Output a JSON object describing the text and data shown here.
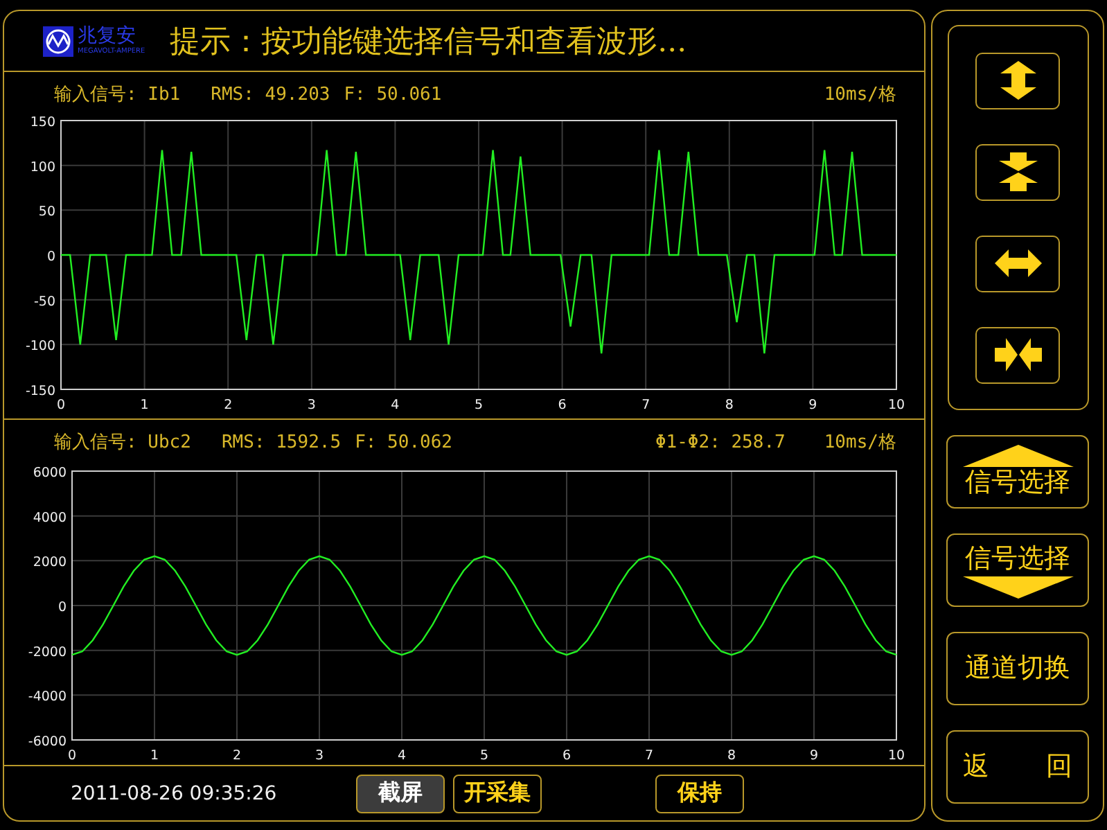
{
  "header": {
    "logo": {
      "name": "兆复安",
      "subtitle": "MEGAVOLT-AMPERE"
    },
    "prompt": "提示：按功能键选择信号和查看波形..."
  },
  "panels": [
    {
      "signal": "输入信号: Ib1",
      "readings": [
        "RMS: 49.203",
        "F: 50.061"
      ],
      "right_readings": [
        "10ms/格"
      ],
      "chart_data": {
        "type": "line",
        "grid": true,
        "xlim": [
          0,
          10
        ],
        "ylim": [
          -150,
          150
        ],
        "xticks": [
          0,
          1,
          2,
          3,
          4,
          5,
          6,
          7,
          8,
          9,
          10
        ],
        "yticks": [
          -150,
          -100,
          -50,
          0,
          50,
          100,
          150
        ],
        "x": [
          0,
          0.11,
          0.23,
          0.35,
          0.54,
          0.66,
          0.78,
          1.09,
          1.21,
          1.33,
          1.44,
          1.56,
          1.68,
          2.1,
          2.22,
          2.34,
          2.42,
          2.54,
          2.66,
          3.06,
          3.18,
          3.3,
          3.41,
          3.53,
          3.65,
          4.06,
          4.18,
          4.3,
          4.52,
          4.64,
          4.76,
          5.05,
          5.17,
          5.29,
          5.38,
          5.5,
          5.62,
          5.98,
          6.1,
          6.22,
          6.35,
          6.47,
          6.59,
          7.04,
          7.16,
          7.28,
          7.39,
          7.51,
          7.63,
          7.97,
          8.09,
          8.21,
          8.3,
          8.42,
          8.54,
          9.02,
          9.14,
          9.26,
          9.35,
          9.47,
          9.59,
          10
        ],
        "series": [
          {
            "color": "#22ee22",
            "values": [
              0,
              0,
              -100,
              0,
              0,
              -95,
              0,
              0,
              117,
              0,
              0,
              115,
              0,
              0,
              -95,
              0,
              0,
              -100,
              0,
              0,
              117,
              0,
              0,
              115,
              0,
              0,
              -95,
              0,
              0,
              -100,
              0,
              0,
              117,
              0,
              0,
              110,
              0,
              0,
              -80,
              0,
              0,
              -110,
              0,
              0,
              117,
              0,
              0,
              115,
              0,
              0,
              -75,
              0,
              0,
              -110,
              0,
              0,
              117,
              0,
              0,
              115,
              0,
              0
            ]
          }
        ]
      }
    },
    {
      "signal": "输入信号: Ubc2",
      "readings": [
        "RMS: 1592.5",
        "F: 50.062"
      ],
      "right_readings": [
        "Φ1-Φ2: 258.7",
        "10ms/格"
      ],
      "chart_data": {
        "type": "line",
        "grid": true,
        "xlim": [
          0,
          10
        ],
        "ylim": [
          -6000,
          6000
        ],
        "xticks": [
          0,
          1,
          2,
          3,
          4,
          5,
          6,
          7,
          8,
          9,
          10
        ],
        "yticks": [
          -6000,
          -4000,
          -2000,
          0,
          2000,
          4000,
          6000
        ],
        "x": [
          0,
          0.125,
          0.25,
          0.375,
          0.5,
          0.625,
          0.75,
          0.875,
          1,
          1.125,
          1.25,
          1.375,
          1.5,
          1.625,
          1.75,
          1.875,
          2,
          2.125,
          2.25,
          2.375,
          2.5,
          2.625,
          2.75,
          2.875,
          3,
          3.125,
          3.25,
          3.375,
          3.5,
          3.625,
          3.75,
          3.875,
          4,
          4.125,
          4.25,
          4.375,
          4.5,
          4.625,
          4.75,
          4.875,
          5,
          5.125,
          5.25,
          5.375,
          5.5,
          5.625,
          5.75,
          5.875,
          6,
          6.125,
          6.25,
          6.375,
          6.5,
          6.625,
          6.75,
          6.875,
          7,
          7.125,
          7.25,
          7.375,
          7.5,
          7.625,
          7.75,
          7.875,
          8,
          8.125,
          8.25,
          8.375,
          8.5,
          8.625,
          8.75,
          8.875,
          9,
          9.125,
          9.25,
          9.375,
          9.5,
          9.625,
          9.75,
          9.875,
          10
        ],
        "series": [
          {
            "color": "#22ee22",
            "values": [
              -2200,
              -2050,
              -1550,
              -850,
              0,
              850,
              1550,
              2050,
              2200,
              2050,
              1550,
              850,
              0,
              -850,
              -1550,
              -2050,
              -2200,
              -2050,
              -1550,
              -850,
              0,
              850,
              1550,
              2050,
              2200,
              2050,
              1550,
              850,
              0,
              -850,
              -1550,
              -2050,
              -2200,
              -2050,
              -1550,
              -850,
              0,
              850,
              1550,
              2050,
              2200,
              2050,
              1550,
              850,
              0,
              -850,
              -1550,
              -2050,
              -2200,
              -2050,
              -1550,
              -850,
              0,
              850,
              1550,
              2050,
              2200,
              2050,
              1550,
              850,
              0,
              -850,
              -1550,
              -2050,
              -2200,
              -2050,
              -1550,
              -850,
              0,
              850,
              1550,
              2050,
              2200,
              2050,
              1550,
              850,
              0,
              -850,
              -1550,
              -2050,
              -2200
            ]
          }
        ]
      }
    }
  ],
  "footer": {
    "datetime": "2011-08-26 09:35:26",
    "buttons": [
      {
        "label": "截屏",
        "selected": true
      },
      {
        "label": "开采集",
        "selected": false
      },
      {
        "label": "保持",
        "selected": false
      }
    ]
  },
  "side_panel": {
    "zoom_buttons": [
      {
        "kind": "expand-vertical"
      },
      {
        "kind": "compress-vertical"
      },
      {
        "kind": "expand-horizontal"
      },
      {
        "kind": "compress-horizontal"
      }
    ],
    "nav_buttons": [
      {
        "label": "信号选择",
        "kind": "up"
      },
      {
        "label": "信号选择",
        "kind": "down"
      },
      {
        "label": "通道切换",
        "kind": "plain"
      },
      {
        "label": "返 回",
        "kind": "spread"
      }
    ]
  }
}
